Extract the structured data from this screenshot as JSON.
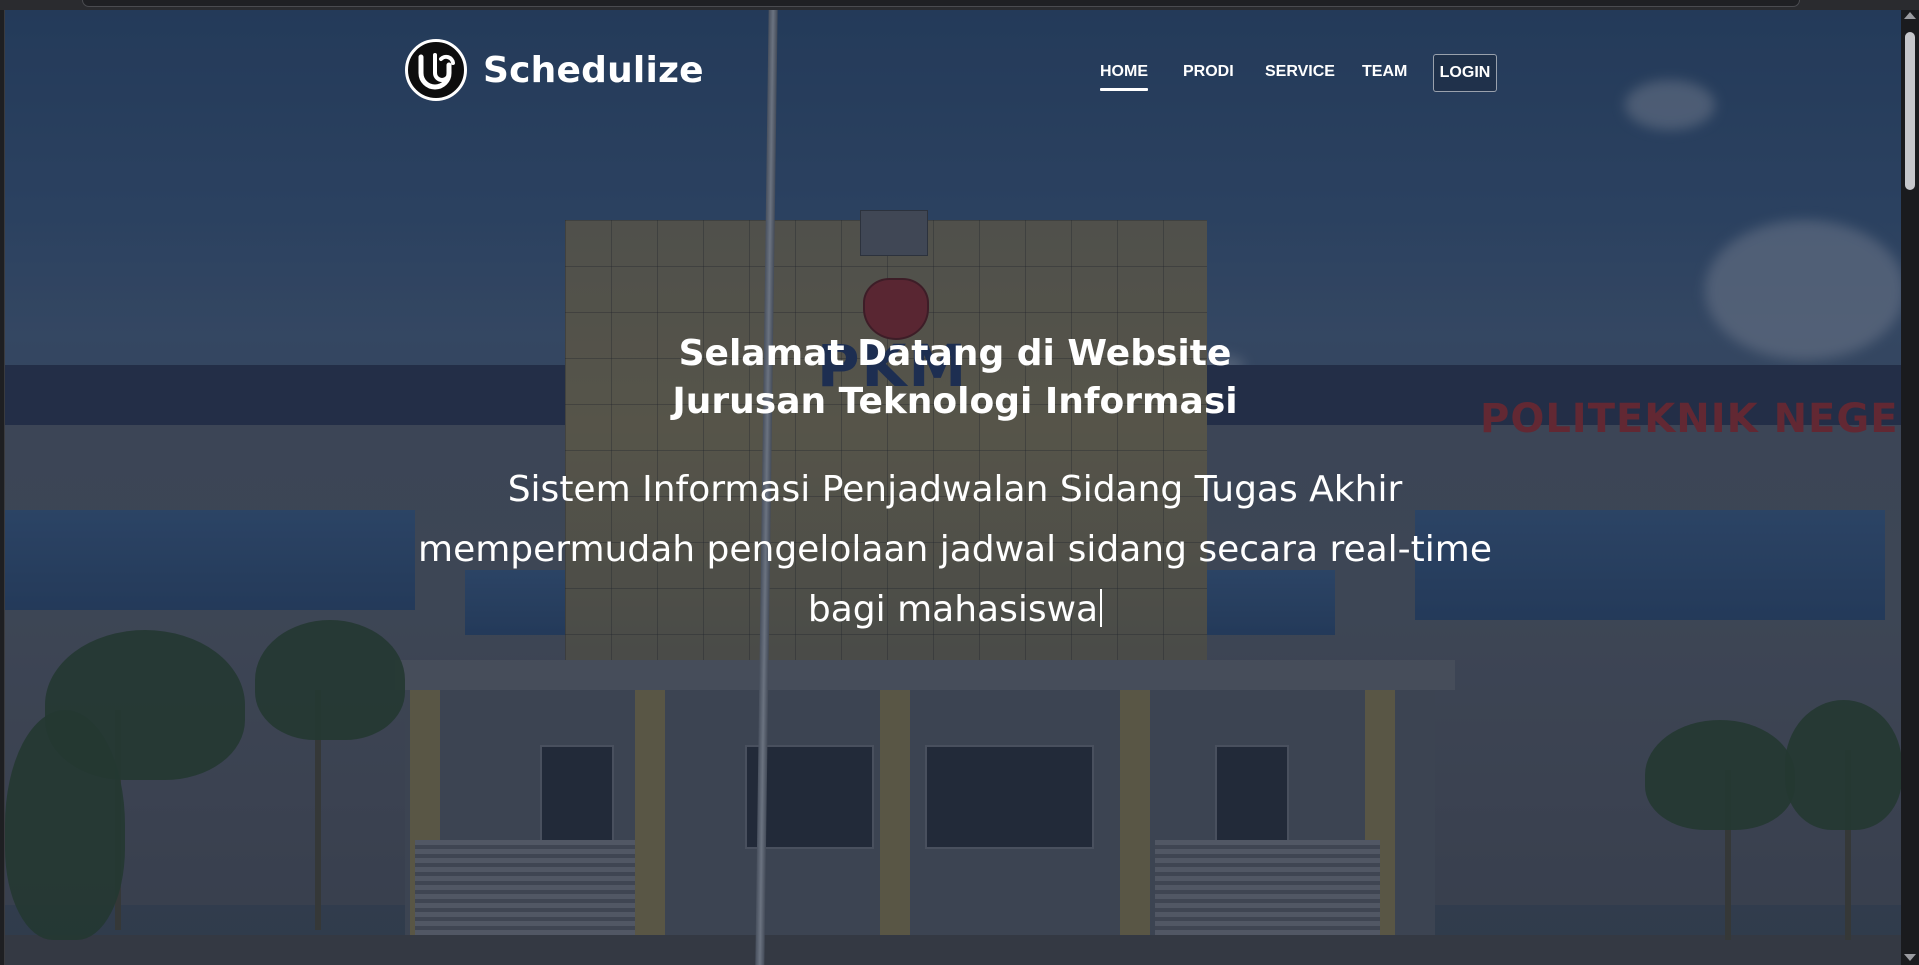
{
  "brand": {
    "name": "Schedulize",
    "logo_icon": "schedulize-logo-icon"
  },
  "nav": {
    "items": [
      {
        "label": "HOME",
        "active": true
      },
      {
        "label": "PRODI",
        "active": false
      },
      {
        "label": "SERVICE",
        "active": false
      },
      {
        "label": "TEAM",
        "active": false
      }
    ],
    "login_label": "LOGIN"
  },
  "hero": {
    "title_line1": "Selamat Datang di Website",
    "title_line2": "Jurusan Teknologi Informasi",
    "subtitle_line1": "Sistem Informasi Penjadwalan Sidang Tugas Akhir",
    "subtitle_line2": "mempermudah pengelolaan jadwal sidang secara real-time",
    "subtitle_line3": "bagi mahasiswa"
  },
  "background": {
    "sign_text": "POLITEKNIK NEGERI P",
    "tower_text": "PKM"
  },
  "colors": {
    "text": "#ffffff",
    "overlay": "#161e30",
    "brand_logo_bg": "#0d0d0d"
  }
}
